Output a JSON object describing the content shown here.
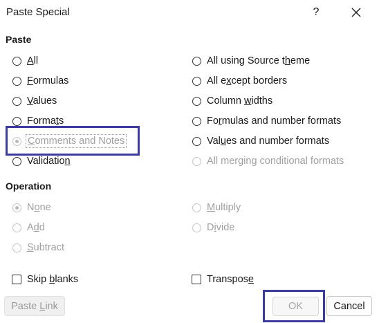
{
  "dialog": {
    "title": "Paste Special",
    "help_symbol": "?",
    "close_icon": "close-icon"
  },
  "paste": {
    "heading": "Paste",
    "options": [
      {
        "id": "all",
        "pre": "",
        "key": "A",
        "post": "ll",
        "enabled": true,
        "checked": false
      },
      {
        "id": "formulas",
        "pre": "",
        "key": "F",
        "post": "ormulas",
        "enabled": true,
        "checked": false
      },
      {
        "id": "values",
        "pre": "",
        "key": "V",
        "post": "alues",
        "enabled": true,
        "checked": false
      },
      {
        "id": "formats",
        "pre": "Forma",
        "key": "t",
        "post": "s",
        "enabled": true,
        "checked": false
      },
      {
        "id": "comments-and-notes",
        "pre": "",
        "key": "C",
        "post": "omments and Notes",
        "enabled": false,
        "checked": true,
        "focused": true
      },
      {
        "id": "validation",
        "pre": "Validatio",
        "key": "n",
        "post": "",
        "enabled": true,
        "checked": false
      },
      {
        "id": "all-using-source-theme",
        "pre": "All using Source t",
        "key": "h",
        "post": "eme",
        "enabled": true,
        "checked": false
      },
      {
        "id": "all-except-borders",
        "pre": "All e",
        "key": "x",
        "post": "cept borders",
        "enabled": true,
        "checked": false
      },
      {
        "id": "column-widths",
        "pre": "Column ",
        "key": "w",
        "post": "idths",
        "enabled": true,
        "checked": false
      },
      {
        "id": "formulas-and-number-formats",
        "pre": "Fo",
        "key": "r",
        "post": "mulas and number formats",
        "enabled": true,
        "checked": false
      },
      {
        "id": "values-and-number-formats",
        "pre": "Val",
        "key": "u",
        "post": "es and number formats",
        "enabled": true,
        "checked": false
      },
      {
        "id": "all-merging-conditional-formats",
        "pre": "All merging conditional formats",
        "key": "",
        "post": "",
        "enabled": false,
        "checked": false
      }
    ]
  },
  "operation": {
    "heading": "Operation",
    "options": [
      {
        "id": "none",
        "pre": "N",
        "key": "o",
        "post": "ne",
        "enabled": false,
        "checked": true
      },
      {
        "id": "add",
        "pre": "A",
        "key": "d",
        "post": "d",
        "enabled": false,
        "checked": false
      },
      {
        "id": "subtract",
        "pre": "",
        "key": "S",
        "post": "ubtract",
        "enabled": false,
        "checked": false
      },
      {
        "id": "multiply",
        "pre": "",
        "key": "M",
        "post": "ultiply",
        "enabled": false,
        "checked": false
      },
      {
        "id": "divide",
        "pre": "D",
        "key": "i",
        "post": "vide",
        "enabled": false,
        "checked": false
      }
    ]
  },
  "checkboxes": [
    {
      "id": "skip-blanks",
      "pre": "Skip ",
      "key": "b",
      "post": "lanks",
      "checked": false
    },
    {
      "id": "transpose",
      "pre": "Transpos",
      "key": "e",
      "post": "",
      "checked": false
    }
  ],
  "buttons": {
    "paste_link": {
      "pre": "Paste ",
      "key": "L",
      "post": "ink",
      "enabled": false
    },
    "ok": {
      "label": "OK",
      "enabled": false
    },
    "cancel": {
      "label": "Cancel",
      "enabled": true
    }
  }
}
